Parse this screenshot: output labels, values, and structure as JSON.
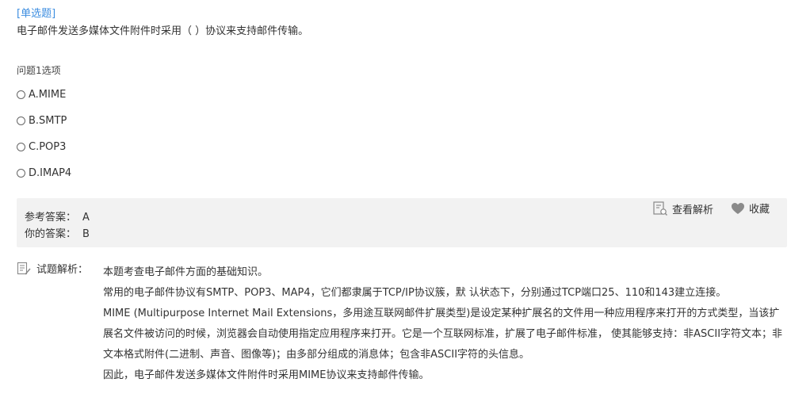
{
  "question": {
    "type_label": "[单选题]",
    "stem": "电子邮件发送多媒体文件附件时采用（  ）协议来支持邮件传输。"
  },
  "options": {
    "heading": "问题1选项",
    "items": [
      {
        "label": "A.MIME",
        "selected": false
      },
      {
        "label": "B.SMTP",
        "selected": false
      },
      {
        "label": "C.POP3",
        "selected": false
      },
      {
        "label": "D.IMAP4",
        "selected": false
      }
    ]
  },
  "answer": {
    "reference_label": "参考答案：",
    "reference_value": "A",
    "yours_label": "你的答案：",
    "yours_value": "B",
    "view_analysis_label": "查看解析",
    "favorite_label": "收藏"
  },
  "analysis": {
    "heading": "试题解析：",
    "paragraphs": [
      "本题考查电子邮件方面的基础知识。",
      "常用的电子邮件协议有SMTP、POP3、MAP4，它们都隶属于TCP/IP协议簇，默 认状态下，分别通过TCP端口25、110和143建立连接。",
      "MIME (Multipurpose Internet Mail Extensions，多用途互联网邮件扩展类型)是设定某种扩展名的文件用一种应用程序来打开的方式类型，当该扩展名文件被访问的时候，浏览器会自动使用指定应用程序来打开。它是一个互联网标准，扩展了电子邮件标准， 使其能够支持：非ASCII字符文本；非文本格式附件(二进制、声音、图像等)；由多部分组成的消息体；包含非ASCII字符的头信息。",
      "因此，电子邮件发送多媒体文件附件时采用MIME协议来支持邮件传输。"
    ]
  },
  "colors": {
    "type_label": "#3d8ee0",
    "answer_bg": "#f2f2f2",
    "icon": "#888888"
  }
}
